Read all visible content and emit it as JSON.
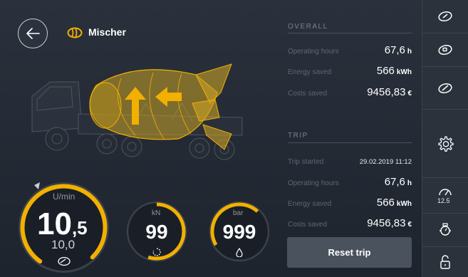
{
  "header": {
    "title": "Mischer",
    "back_icon": "arrow-left-icon",
    "mixer_icon": "mixer-drum-icon"
  },
  "gauges": {
    "speed": {
      "unit": "U/min",
      "value_main": "10",
      "value_decimal": ",5",
      "setpoint": "10,0",
      "fill_fraction": 0.78,
      "icon": "drum-rotation-icon"
    },
    "force": {
      "unit": "kN",
      "value": "99",
      "fill_fraction": 0.55,
      "icon": "rotation-dial-icon"
    },
    "pressure": {
      "unit": "bar",
      "value": "999",
      "fill_fraction": 0.45,
      "icon": "drop-icon"
    }
  },
  "overall": {
    "title": "OVERALL",
    "operating_hours": {
      "label": "Operating hours",
      "value": "67,6",
      "unit": "h"
    },
    "energy_saved": {
      "label": "Energy saved",
      "value": "566",
      "unit": "kWh"
    },
    "costs_saved": {
      "label": "Costs saved",
      "value": "9456,83",
      "unit": "€"
    }
  },
  "trip": {
    "title": "TRIP",
    "trip_started": {
      "label": "Trip started",
      "value": "29.02.2019 11:12"
    },
    "operating_hours": {
      "label": "Operating hours",
      "value": "67,6",
      "unit": "h"
    },
    "energy_saved": {
      "label": "Energy saved",
      "value": "566",
      "unit": "kWh"
    },
    "costs_saved": {
      "label": "Costs saved",
      "value": "9456,83",
      "unit": "€"
    },
    "reset_label": "Reset trip"
  },
  "sidebar": {
    "items": [
      {
        "icon": "drum-view-1-icon"
      },
      {
        "icon": "drum-view-2-icon"
      },
      {
        "icon": "drum-view-3-icon"
      },
      {
        "icon": "settings-gear-icon"
      },
      {
        "icon": "speed-limit-icon",
        "label": "12.5"
      },
      {
        "icon": "drum-pressure-icon"
      },
      {
        "icon": "lock-open-icon"
      }
    ]
  },
  "colors": {
    "accent": "#f2b000",
    "background": "#1f2530",
    "panel": "#2b323c"
  }
}
